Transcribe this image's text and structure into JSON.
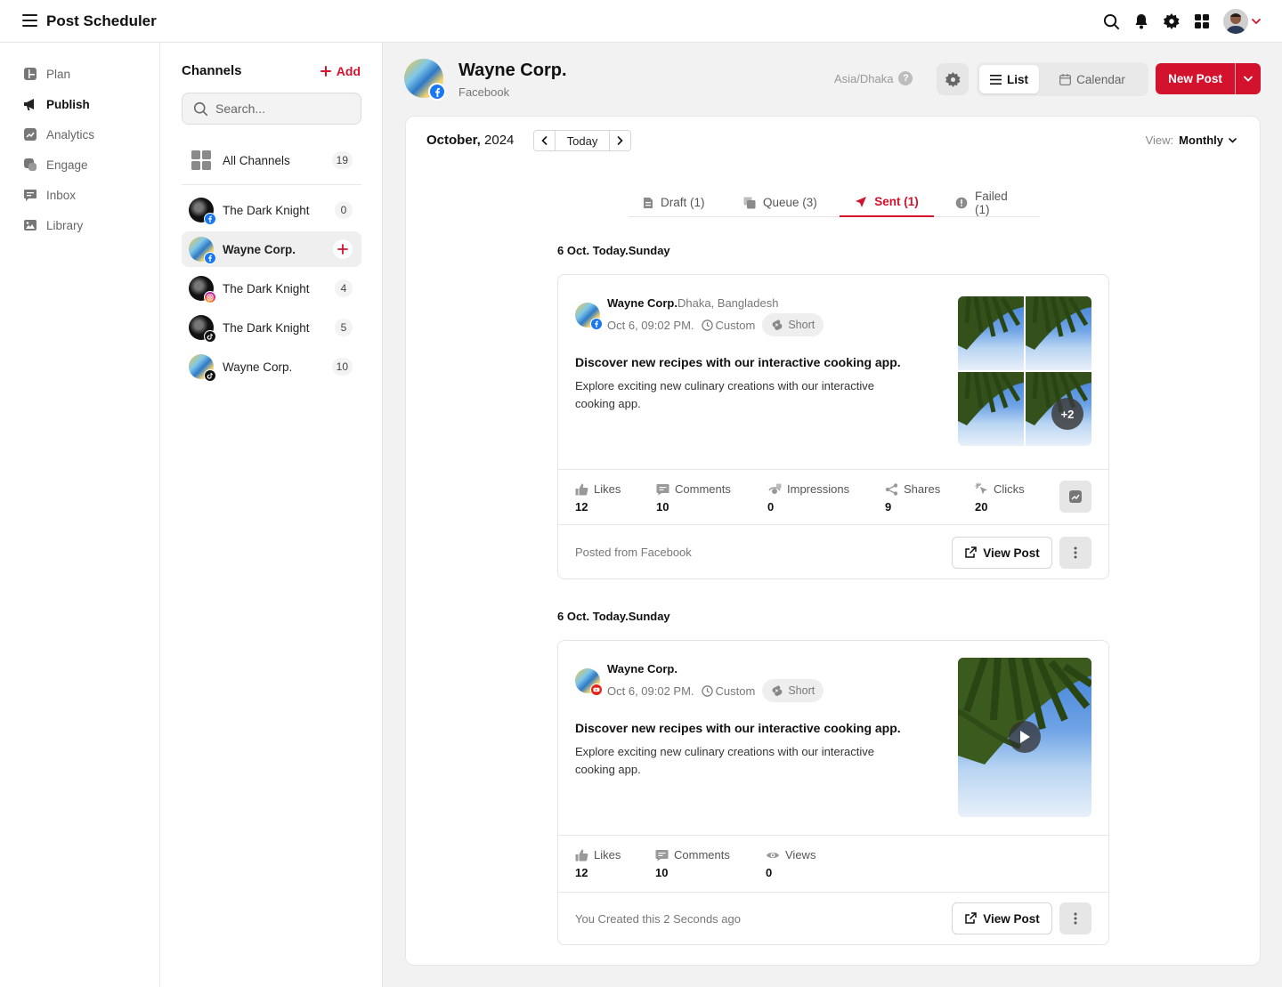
{
  "app": {
    "title": "Post Scheduler"
  },
  "nav": {
    "items": [
      {
        "label": "Plan",
        "icon": "plan-icon"
      },
      {
        "label": "Publish",
        "icon": "megaphone-icon"
      },
      {
        "label": "Analytics",
        "icon": "analytics-icon"
      },
      {
        "label": "Engage",
        "icon": "engage-icon"
      },
      {
        "label": "Inbox",
        "icon": "inbox-icon"
      },
      {
        "label": "Library",
        "icon": "library-icon"
      }
    ],
    "active": "Publish"
  },
  "channels": {
    "title": "Channels",
    "add_label": "Add",
    "search_placeholder": "Search...",
    "all": {
      "label": "All Channels",
      "count": "19"
    },
    "items": [
      {
        "name": "The Dark Knight",
        "count": "0",
        "platform": "facebook"
      },
      {
        "name": "Wayne Corp.",
        "count": "",
        "platform": "facebook",
        "active": true
      },
      {
        "name": "The Dark Knight",
        "count": "4",
        "platform": "instagram"
      },
      {
        "name": "The Dark Knight",
        "count": "5",
        "platform": "tiktok"
      },
      {
        "name": "Wayne Corp.",
        "count": "10",
        "platform": "tiktok"
      }
    ]
  },
  "header": {
    "account_name": "Wayne Corp.",
    "account_platform": "Facebook",
    "timezone": "Asia/Dhaka",
    "help": "?",
    "view_list": "List",
    "view_calendar": "Calendar",
    "new_post": "New Post"
  },
  "calendar": {
    "month": "October,",
    "year": "2024",
    "today": "Today",
    "view_label": "View:",
    "view_value": "Monthly"
  },
  "tabs": [
    {
      "label": "Draft (1)",
      "icon": "draft-icon"
    },
    {
      "label": "Queue (3)",
      "icon": "queue-icon"
    },
    {
      "label": "Sent (1)",
      "icon": "send-icon",
      "active": true
    },
    {
      "label": "Failed (1)",
      "icon": "alert-icon"
    }
  ],
  "posts": [
    {
      "date_heading": "6 Oct. Today.Sunday",
      "account": "Wayne Corp.",
      "location": "Dhaka, Bangladesh",
      "time": "Oct 6, 09:02 PM.",
      "schedule_type": "Custom",
      "format": "Short",
      "title": "Discover new recipes with our interactive cooking app.",
      "body": "Explore exciting new culinary creations with our interactive cooking app.",
      "extra_media": "+2",
      "stats": [
        {
          "label": "Likes",
          "value": "12"
        },
        {
          "label": "Comments",
          "value": "10"
        },
        {
          "label": "Impressions",
          "value": "0"
        },
        {
          "label": "Shares",
          "value": "9"
        },
        {
          "label": "Clicks",
          "value": "20"
        }
      ],
      "footer": "Posted from Facebook",
      "view_post": "View Post"
    },
    {
      "date_heading": "6 Oct. Today.Sunday",
      "account": "Wayne Corp.",
      "location": "",
      "time": "Oct 6, 09:02 PM.",
      "schedule_type": "Custom",
      "format": "Short",
      "title": "Discover new recipes with our interactive cooking app.",
      "body": "Explore exciting new culinary creations with our interactive cooking app.",
      "stats": [
        {
          "label": "Likes",
          "value": "12"
        },
        {
          "label": "Comments",
          "value": "10"
        },
        {
          "label": "Views",
          "value": "0"
        }
      ],
      "footer": "You Created this 2 Seconds ago",
      "view_post": "View Post"
    }
  ],
  "colors": {
    "accent": "#d3122e",
    "facebook": "#1877f2",
    "youtube": "#e62117"
  }
}
